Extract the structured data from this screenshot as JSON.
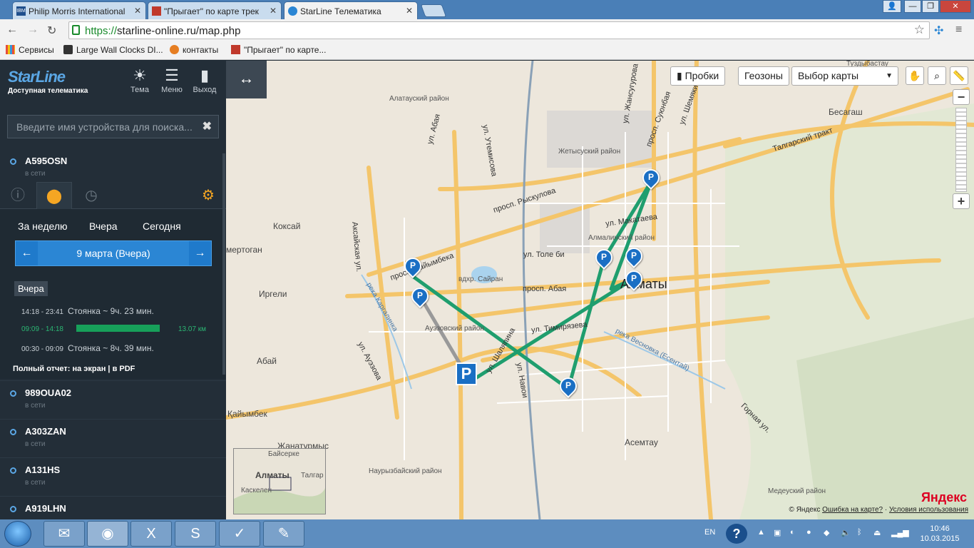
{
  "browser": {
    "tabs": [
      {
        "label": "Philip Morris International",
        "icon": "ibm-icon"
      },
      {
        "label": "\"Прыгает\" по карте трек",
        "icon": "page-icon"
      },
      {
        "label": "StarLine Телематика",
        "icon": "starline-icon"
      }
    ],
    "url_scheme": "https://",
    "url_rest": "starline-online.ru/map.php",
    "bookmarks": [
      {
        "label": "Сервисы",
        "icon": "apps-icon"
      },
      {
        "label": "Large Wall Clocks DI...",
        "icon": "clock-icon"
      },
      {
        "label": "контакты",
        "icon": "joomla-icon"
      },
      {
        "label": "\"Прыгает\" по карте...",
        "icon": "page-icon"
      }
    ]
  },
  "sidebar": {
    "logo": "StarLine",
    "tagline": "Доступная телематика",
    "header_buttons": [
      {
        "label": "Тема",
        "icon": "sun-icon"
      },
      {
        "label": "Меню",
        "icon": "menu-icon"
      },
      {
        "label": "Выход",
        "icon": "exit-icon"
      }
    ],
    "search_placeholder": "Введите имя устройства для поиска...",
    "devices": [
      {
        "name": "A595OSN",
        "status": "в сети"
      },
      {
        "name": "989OUA02",
        "status": "в сети"
      },
      {
        "name": "A303ZAN",
        "status": "в сети"
      },
      {
        "name": "A131HS",
        "status": "в сети"
      },
      {
        "name": "A919LHN",
        "status": ""
      }
    ],
    "periods": [
      "За неделю",
      "Вчера",
      "Сегодня"
    ],
    "date_label": "9 марта (Вчера)",
    "prev_arrow": "←",
    "next_arrow": "→",
    "day_badge": "Вчера",
    "events": [
      {
        "time": "14:18 - 23:41",
        "desc": "Стоянка ~ 9ч. 23 мин."
      },
      {
        "time": "09:09 - 14:18",
        "desc": "",
        "distance": "13.07 км"
      },
      {
        "time": "00:30 - 09:09",
        "desc": "Стоянка ~ 8ч. 39 мин."
      }
    ],
    "report": "Полный отчет: на экран  |  в PDF"
  },
  "map": {
    "buttons": {
      "traffic": "Пробки",
      "geofences": "Геозоны",
      "map_select": "Выбор карты"
    },
    "labels": {
      "city": "Алматы",
      "alatau": "Алатауский район",
      "zhetysu": "Жетысуский район",
      "almaly": "Алмалинский район",
      "auezov": "Ауэзовский район",
      "nauryzbay": "Наурызбайский район",
      "medeu": "Медеуский район",
      "koksai": "Коксай",
      "irgeli": "Иргели",
      "abai_town": "Абай",
      "kaiymbek": "Қайымбек",
      "zhanaturmys": "Жанатурмыс",
      "asemtau": "Асемтау",
      "besagash": "Бесагаш",
      "tuzdybastau": "Туздыбастау",
      "ergenergotan": "мертоган",
      "sairan": "вдхр. Сайран",
      "tolebi": "ул. Толе би",
      "abai_ave": "просп. Абая",
      "timiryazev": "ул. Тимирязева",
      "raiymbek": "просп. Райымбека",
      "ryskulov": "просп. Рыскулова",
      "makataev": "ул. Макатаева",
      "suyunbai": "просп. Суюнбая",
      "talgar_tract": "Талгарский тракт",
      "auezov_st": "ул. Ауэзова",
      "aksai": "Аксайская ул.",
      "navoi": "ул. Навои",
      "shalyapin": "ул. Шаляпина",
      "gornaya": "Горная ул.",
      "vesnovka": "река Весновка (Есентай)",
      "kargalinka": "река Каргалинка",
      "abai_st": "ул. Абая",
      "utemisov": "ул. Утемисова",
      "zhansugurov": "ул. Жансугурова",
      "shemyakin": "ул. Шемякина"
    },
    "mini_labels": {
      "baiserke": "Байсерке",
      "almaty": "Алматы",
      "talgar": "Талгар",
      "kaskelen": "Каскелен"
    },
    "pin_letter": "P",
    "copyright": "© Яндекс",
    "error_link": "Ошибка на карте?",
    "terms_link": "Условия использования",
    "yandex": "Яндекс",
    "track_color": "#1f9e6e"
  },
  "taskbar": {
    "lang": "EN",
    "time": "10:46",
    "date": "10.03.2015"
  }
}
